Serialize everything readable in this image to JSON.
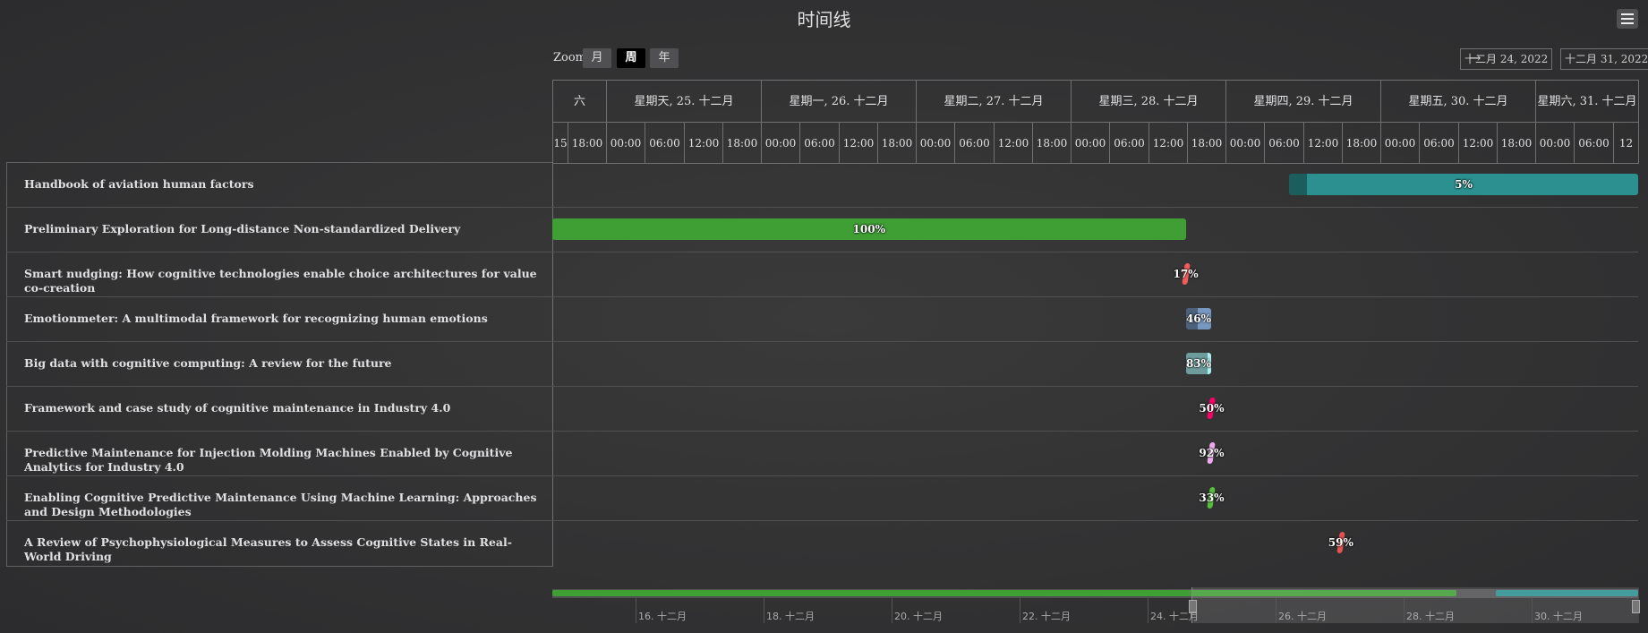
{
  "title": "时间线",
  "zoom": {
    "label": "Zoom",
    "buttons": [
      "月",
      "周",
      "年"
    ],
    "selected": "周"
  },
  "range": {
    "from": "十二月 24, 2022",
    "arrow": "→",
    "to": "十二月 31, 2022"
  },
  "header": {
    "days": [
      "六",
      "星期天, 25. 十二月",
      "星期一, 26. 十二月",
      "星期二, 27. 十二月",
      "星期三, 28. 十二月",
      "星期四, 29. 十二月",
      "星期五, 30. 十二月",
      "星期六, 31. 十二月"
    ],
    "hours": [
      "15",
      "18:00",
      "00:00",
      "06:00",
      "12:00",
      "18:00",
      "00:00",
      "06:00",
      "12:00",
      "18:00",
      "00:00",
      "06:00",
      "12:00",
      "18:00",
      "00:00",
      "06:00",
      "12:00",
      "18:00",
      "00:00",
      "06:00",
      "12:00",
      "18:00",
      "00:00",
      "06:00",
      "12:00",
      "18:00",
      "00:00",
      "06:00",
      "12"
    ]
  },
  "navigator": {
    "ticks": [
      "16. 十二月",
      "18. 十二月",
      "20. 十二月",
      "22. 十二月",
      "24. 十二月",
      "26. 十二月",
      "28. 十二月",
      "30. 十二月"
    ]
  },
  "chart_data": {
    "type": "gantt",
    "title": "时间线",
    "x_range": [
      "2022-12-24 14:00",
      "2022-12-31 14:00"
    ],
    "tasks": [
      {
        "name": "Handbook of aviation human factors",
        "start": "2022-12-29 08:00",
        "end": "2022-12-31 14:00",
        "completed": 0.05,
        "label": "5%",
        "color": "#2b908f"
      },
      {
        "name": "Preliminary Exploration for Long-distance Non-standardized Delivery",
        "start": "2022-12-24 14:00",
        "end": "2022-12-28 16:00",
        "completed": 1.0,
        "label": "100%",
        "color": "#3f9f35"
      },
      {
        "name": "Smart nudging: How cognitive technologies enable choice architectures for value co-creation",
        "start": "2022-12-28 16:00",
        "end": "2022-12-28 16:00",
        "completed": 0.17,
        "label": "17%",
        "color": "#f45b5b"
      },
      {
        "name": "Emotionmeter: A multimodal framework for recognizing human emotions",
        "start": "2022-12-28 16:00",
        "end": "2022-12-28 20:00",
        "completed": 0.46,
        "label": "46%",
        "color": "#7798bf"
      },
      {
        "name": "Big data with cognitive computing: A review for the future",
        "start": "2022-12-28 16:00",
        "end": "2022-12-28 20:00",
        "completed": 0.83,
        "label": "83%",
        "color": "#aaeeee"
      },
      {
        "name": "Framework and case study of cognitive maintenance in Industry 4.0",
        "start": "2022-12-28 20:00",
        "end": "2022-12-28 20:00",
        "completed": 0.5,
        "label": "50%",
        "color": "#ff0066"
      },
      {
        "name": "Predictive Maintenance for Injection Molding Machines Enabled by Cognitive Analytics for Industry 4.0",
        "start": "2022-12-28 20:00",
        "end": "2022-12-28 20:00",
        "completed": 0.92,
        "label": "92%",
        "color": "#eeaaee"
      },
      {
        "name": "Enabling Cognitive Predictive Maintenance Using Machine Learning: Approaches and Design Methodologies",
        "start": "2022-12-28 20:00",
        "end": "2022-12-28 20:00",
        "completed": 0.33,
        "label": "33%",
        "color": "#55bf3b"
      },
      {
        "name": "A Review of Psychophysiological Measures to Assess Cognitive States in Real-World Driving",
        "start": "2022-12-29 16:00",
        "end": "2022-12-29 16:00",
        "completed": 0.59,
        "label": "59%",
        "color": "#df5353"
      }
    ]
  }
}
